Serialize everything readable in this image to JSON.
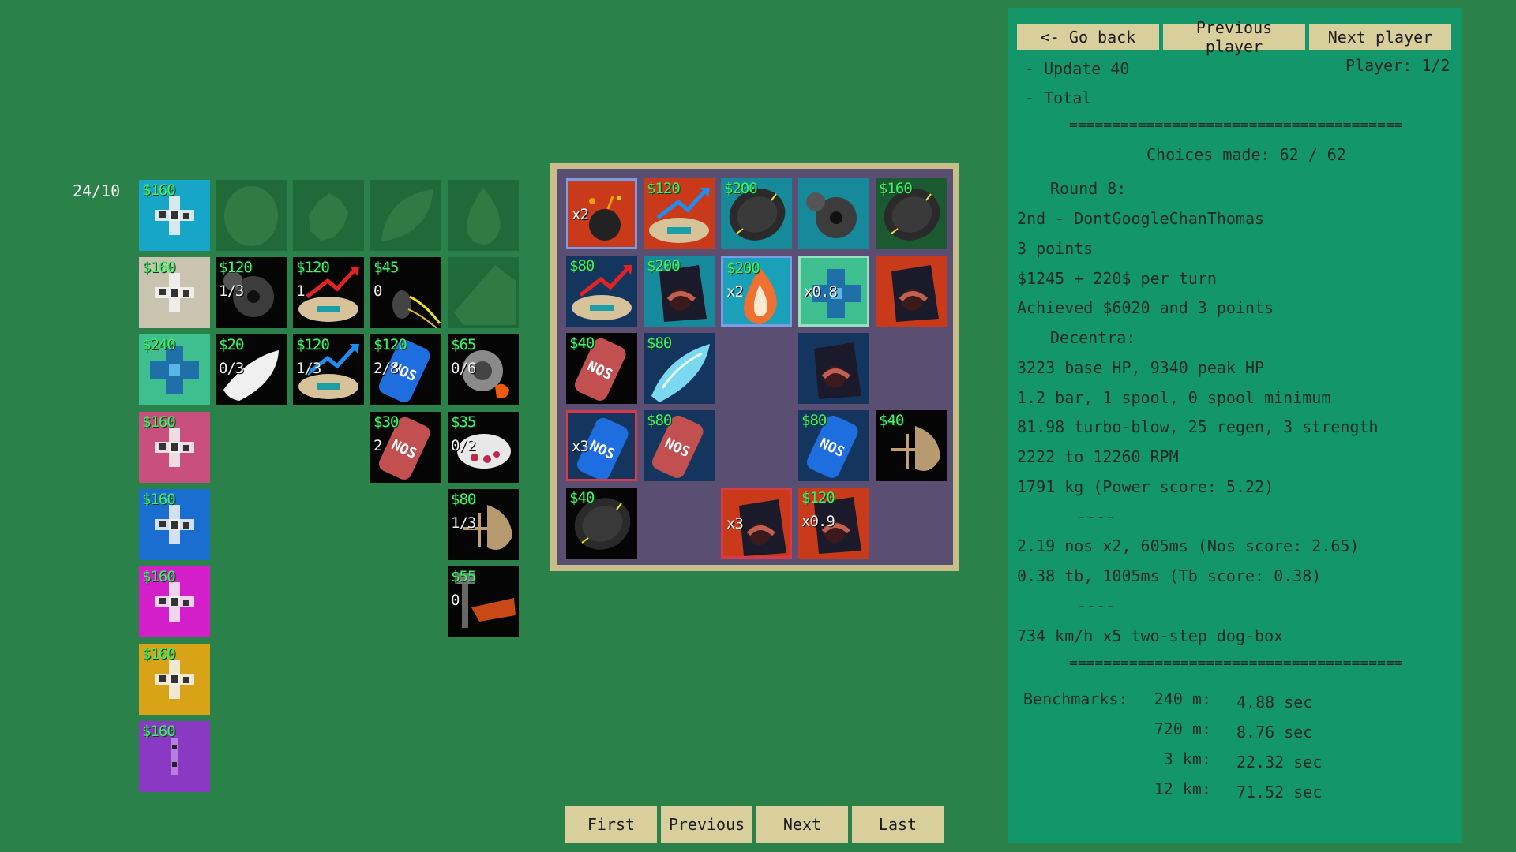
{
  "counter": "24/10",
  "nav_buttons": {
    "first": "First",
    "previous": "Previous",
    "next": "Next",
    "last": "Last"
  },
  "panel": {
    "go_back": "<- Go back",
    "previous_player": "Previous player",
    "next_player": "Next player",
    "player": "Player: 1/2",
    "lines": [
      "- Update 40",
      "- Total",
      "=======================================",
      "Choices made: 62 / 62",
      "Round 8:",
      "2nd - DontGoogleChanThomas",
      "3 points",
      "$1245 + 220$ per turn",
      "Achieved $6020 and 3 points",
      "Decentra:",
      "3223 base HP, 9340 peak HP",
      "1.2 bar, 1 spool, 0 spool minimum",
      "81.98 turbo-blow, 25 regen, 3 strength",
      "2222 to 12260 RPM",
      "1791 kg (Power score: 5.22)",
      "----",
      "2.19 nos x2, 605ms (Nos score: 2.65)",
      "0.38 tb, 1005ms (Tb score: 0.38)",
      "----",
      "734 km/h x5 two-step dog-box",
      "======================================="
    ],
    "benchmarks_label": "Benchmarks:",
    "benchmarks": [
      {
        "dist": "240 m:",
        "time": "4.88 sec"
      },
      {
        "dist": "720 m:",
        "time": "8.76 sec"
      },
      {
        "dist": "3 km:",
        "time": "22.32 sec"
      },
      {
        "dist": "12 km:",
        "time": "71.52 sec"
      }
    ]
  },
  "shapes": [
    {
      "price": "$160",
      "color": "#18a6c8",
      "icon": "cross-shape-icon"
    },
    {
      "price": "$160",
      "color": "#c9c3b0",
      "icon": "cross-shape-icon"
    },
    {
      "price": "$240",
      "color": "#3fbf8f",
      "icon": "big-cross-shape-icon"
    },
    {
      "price": "$160",
      "color": "#c94f7e",
      "icon": "cross-shape-icon"
    },
    {
      "price": "$160",
      "color": "#1a6ed0",
      "icon": "cross-shape-icon"
    },
    {
      "price": "$160",
      "color": "#d41ec9",
      "icon": "cross-shape-icon"
    },
    {
      "price": "$160",
      "color": "#d8a317",
      "icon": "cross-shape-icon"
    },
    {
      "price": "$160",
      "color": "#8a3ac2",
      "icon": "line-shape-icon"
    }
  ],
  "shop": {
    "row1": [
      {
        "icon": "tire-silhouette-icon"
      },
      {
        "icon": "gear-silhouette-icon"
      },
      {
        "icon": "leaf-silhouette-icon"
      },
      {
        "icon": "fire-silhouette-icon"
      }
    ],
    "row2": [
      {
        "price": "$120",
        "sub": "1/3",
        "icon": "gears-icon"
      },
      {
        "price": "$120",
        "sub": "1",
        "icon": "boost-arrow-red-icon"
      },
      {
        "price": "$45",
        "sub": "0",
        "icon": "spark-tire-icon"
      },
      {
        "icon": "box-silhouette-icon"
      }
    ],
    "row3": [
      {
        "price": "$20",
        "sub": "0/3",
        "icon": "wing-icon"
      },
      {
        "price": "$120",
        "sub": "1/3",
        "icon": "boost-arrow-blue-icon"
      },
      {
        "price": "$120",
        "sub": "2/8",
        "icon": "nos-blue-icon"
      },
      {
        "price": "$65",
        "sub": "0/6",
        "icon": "turbo-icon"
      }
    ],
    "row4": [
      {
        "price": "$30",
        "sub": "2",
        "icon": "nos-red-icon"
      },
      {
        "price": "$35",
        "sub": "0/2",
        "icon": "brain-icon"
      }
    ],
    "row5": [
      {
        "price": "$80",
        "sub": "1/3",
        "icon": "scales-icon"
      }
    ],
    "row6": [
      {
        "price": "$55",
        "sub": "0",
        "icon": "pipe-icon"
      }
    ]
  },
  "board": [
    [
      {
        "price": "",
        "mult": "x2",
        "icon": "bomb-icon",
        "bg": "#c93a1a",
        "border": "#7a9de6"
      },
      {
        "price": "$120",
        "mult": "",
        "icon": "boost-arrow-blue-icon",
        "bg": "#c93a1a"
      },
      {
        "price": "$200",
        "mult": "",
        "icon": "tire-icon",
        "bg": "#168a9a"
      },
      {
        "price": "",
        "mult": "",
        "icon": "gears-icon",
        "bg": "#168a9a"
      },
      {
        "price": "$160",
        "mult": "",
        "icon": "tire-icon",
        "bg": "#1b5a30"
      }
    ],
    [
      {
        "price": "$80",
        "mult": "",
        "icon": "boost-arrow-red-icon",
        "bg": "#14365e"
      },
      {
        "price": "$200",
        "mult": "",
        "icon": "exhaust-icon",
        "bg": "#168a9a"
      },
      {
        "price": "$200",
        "mult": "x2",
        "icon": "flame-icon",
        "bg": "#1aa0b8",
        "border": "#7a9de6"
      },
      {
        "price": "",
        "mult": "x0.8",
        "icon": "big-cross-shape-icon",
        "bg": "#3fbf8f",
        "border": "#9ae0c0"
      },
      {
        "price": "",
        "mult": "",
        "icon": "exhaust-icon",
        "bg": "#c93a1a"
      }
    ],
    [
      {
        "price": "$40",
        "mult": "",
        "icon": "nos-red-icon",
        "bg": "#050505"
      },
      {
        "price": "$80",
        "mult": "",
        "icon": "ice-wing-icon",
        "bg": "#14365e"
      },
      null,
      {
        "price": "",
        "mult": "",
        "icon": "exhaust-icon",
        "bg": "#14365e"
      },
      null
    ],
    [
      {
        "price": "",
        "mult": "x3",
        "icon": "nos-blue-icon",
        "bg": "#14365e",
        "border": "#d83a4a"
      },
      {
        "price": "$80",
        "mult": "",
        "icon": "nos-red-icon",
        "bg": "#14365e"
      },
      null,
      {
        "price": "$80",
        "mult": "",
        "icon": "nos-blue-icon",
        "bg": "#14365e"
      },
      {
        "price": "$40",
        "mult": "",
        "icon": "scales-icon",
        "bg": "#050505"
      }
    ],
    [
      {
        "price": "$40",
        "mult": "",
        "icon": "tire-icon",
        "bg": "#050505"
      },
      null,
      {
        "price": "",
        "mult": "x3",
        "icon": "exhaust-icon",
        "bg": "#c93a1a",
        "border": "#d83a4a"
      },
      {
        "price": "$120",
        "mult": "x0.9",
        "icon": "exhaust-icon",
        "bg": "#c93a1a"
      },
      null
    ]
  ]
}
